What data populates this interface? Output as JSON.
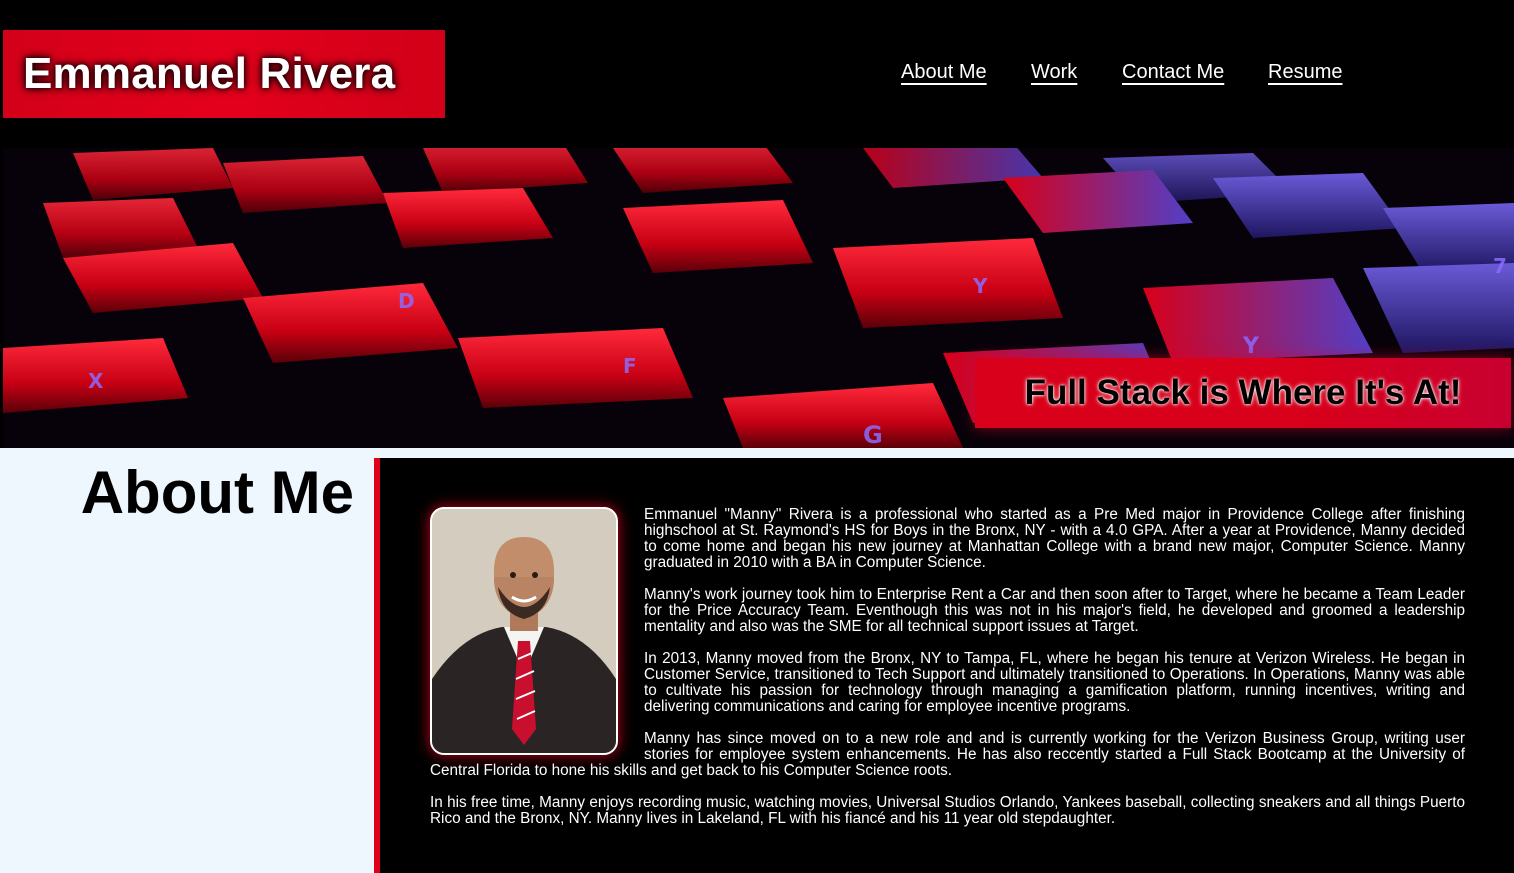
{
  "brand": {
    "name": "Emmanuel Rivera"
  },
  "nav": {
    "items": [
      {
        "label": "About Me"
      },
      {
        "label": "Work"
      },
      {
        "label": "Contact Me"
      },
      {
        "label": "Resume"
      }
    ]
  },
  "hero": {
    "tagline": "Full Stack is Where It's At!",
    "key_labels": [
      "X",
      "D",
      "F",
      "G",
      "Y",
      "Y",
      "7"
    ]
  },
  "about": {
    "title": "About Me",
    "paragraphs": [
      "Emmanuel \"Manny\" Rivera is a professional who started as a Pre Med major in Providence College after finishing highschool at St. Raymond's HS for Boys in the Bronx, NY - with a 4.0 GPA. After a year at Providence, Manny decided to come home and began his new journey at Manhattan College with a brand new major, Computer Science. Manny graduated in 2010 with a BA in Computer Science.",
      "Manny's work journey took him to Enterprise Rent a Car and then soon after to Target, where he became a Team Leader for the Price Accuracy Team. Eventhough this was not in his major's field, he developed and groomed a leadership mentality and also was the SME for all technical support issues at Target.",
      "In 2013, Manny moved from the Bronx, NY to Tampa, FL, where he began his tenure at Verizon Wireless. He began in Customer Service, transitioned to Tech Support and ultimately transitioned to Operations. In Operations, Manny was able to cultivate his passion for technology through managing a gamification platform, running incentives, writing and delivering communications and caring for employee incentive programs.",
      "Manny has since moved on to a new role and and is currently working for the Verizon Business Group, writing user stories for employee system enhancements. He has also reccently started a Full Stack Bootcamp at the University of Central Florida to hone his skills and get back to his Computer Science roots.",
      "In his free time, Manny enjoys recording music, watching movies, Universal Studios Orlando, Yankees baseball, collecting sneakers and all things Puerto Rico and the Bronx, NY. Manny lives in Lakeland, FL with his fiancé and his 11 year old stepdaughter."
    ]
  },
  "colors": {
    "accent_red": "#e0001b",
    "background": "#000000",
    "sidebar": "#eef6fe",
    "text": "#ffffff"
  }
}
